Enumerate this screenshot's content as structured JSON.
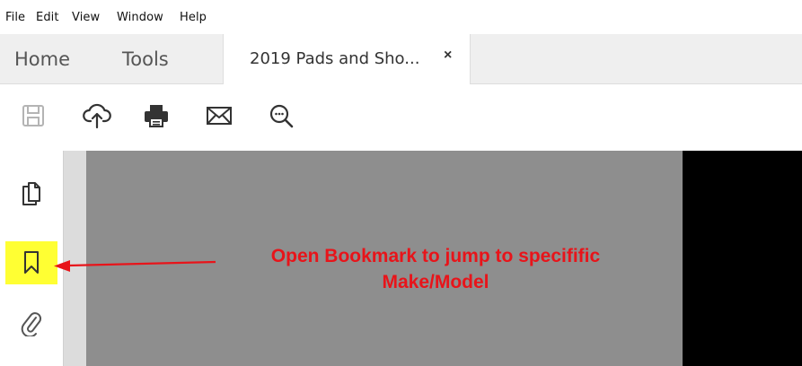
{
  "menubar": {
    "items": [
      "File",
      "Edit",
      "View",
      "Window",
      "Help"
    ]
  },
  "tabs": {
    "home": "Home",
    "tools": "Tools",
    "document": "2019 Pads and Sho...",
    "close_glyph": "×"
  },
  "toolbar": {
    "icons": [
      "save-icon",
      "cloud-upload-icon",
      "print-icon",
      "email-icon",
      "zoom-out-icon"
    ]
  },
  "leftnav": {
    "icons": [
      "page-thumbnails-icon",
      "bookmark-icon",
      "attachment-icon"
    ],
    "highlight_color": "#ffff33"
  },
  "annotation": {
    "line1": "Open Bookmark to jump to specifific",
    "line2": "Make/Model",
    "color": "#e8141a"
  },
  "colors": {
    "doc_background": "#8e8e8e",
    "dark_area": "#000000",
    "tabbar": "#efefef"
  }
}
